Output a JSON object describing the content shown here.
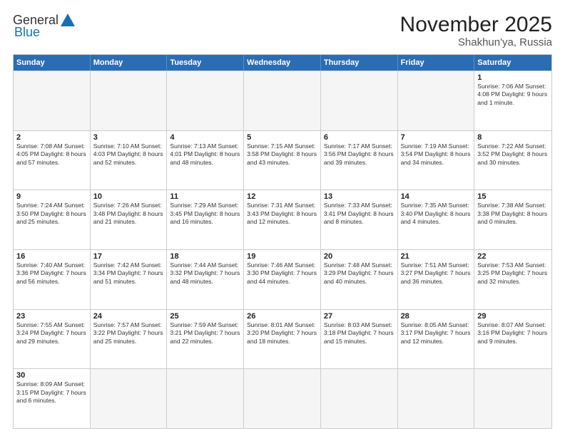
{
  "header": {
    "logo_general": "General",
    "logo_blue": "Blue",
    "title": "November 2025",
    "subtitle": "Shakhun'ya, Russia"
  },
  "weekdays": [
    "Sunday",
    "Monday",
    "Tuesday",
    "Wednesday",
    "Thursday",
    "Friday",
    "Saturday"
  ],
  "weeks": [
    [
      {
        "day": "",
        "info": "",
        "empty": true
      },
      {
        "day": "",
        "info": "",
        "empty": true
      },
      {
        "day": "",
        "info": "",
        "empty": true
      },
      {
        "day": "",
        "info": "",
        "empty": true
      },
      {
        "day": "",
        "info": "",
        "empty": true
      },
      {
        "day": "",
        "info": "",
        "empty": true
      },
      {
        "day": "1",
        "info": "Sunrise: 7:06 AM\nSunset: 4:08 PM\nDaylight: 9 hours\nand 1 minute."
      }
    ],
    [
      {
        "day": "2",
        "info": "Sunrise: 7:08 AM\nSunset: 4:05 PM\nDaylight: 8 hours\nand 57 minutes."
      },
      {
        "day": "3",
        "info": "Sunrise: 7:10 AM\nSunset: 4:03 PM\nDaylight: 8 hours\nand 52 minutes."
      },
      {
        "day": "4",
        "info": "Sunrise: 7:13 AM\nSunset: 4:01 PM\nDaylight: 8 hours\nand 48 minutes."
      },
      {
        "day": "5",
        "info": "Sunrise: 7:15 AM\nSunset: 3:58 PM\nDaylight: 8 hours\nand 43 minutes."
      },
      {
        "day": "6",
        "info": "Sunrise: 7:17 AM\nSunset: 3:56 PM\nDaylight: 8 hours\nand 39 minutes."
      },
      {
        "day": "7",
        "info": "Sunrise: 7:19 AM\nSunset: 3:54 PM\nDaylight: 8 hours\nand 34 minutes."
      },
      {
        "day": "8",
        "info": "Sunrise: 7:22 AM\nSunset: 3:52 PM\nDaylight: 8 hours\nand 30 minutes."
      }
    ],
    [
      {
        "day": "9",
        "info": "Sunrise: 7:24 AM\nSunset: 3:50 PM\nDaylight: 8 hours\nand 25 minutes."
      },
      {
        "day": "10",
        "info": "Sunrise: 7:26 AM\nSunset: 3:48 PM\nDaylight: 8 hours\nand 21 minutes."
      },
      {
        "day": "11",
        "info": "Sunrise: 7:29 AM\nSunset: 3:45 PM\nDaylight: 8 hours\nand 16 minutes."
      },
      {
        "day": "12",
        "info": "Sunrise: 7:31 AM\nSunset: 3:43 PM\nDaylight: 8 hours\nand 12 minutes."
      },
      {
        "day": "13",
        "info": "Sunrise: 7:33 AM\nSunset: 3:41 PM\nDaylight: 8 hours\nand 8 minutes."
      },
      {
        "day": "14",
        "info": "Sunrise: 7:35 AM\nSunset: 3:40 PM\nDaylight: 8 hours\nand 4 minutes."
      },
      {
        "day": "15",
        "info": "Sunrise: 7:38 AM\nSunset: 3:38 PM\nDaylight: 8 hours\nand 0 minutes."
      }
    ],
    [
      {
        "day": "16",
        "info": "Sunrise: 7:40 AM\nSunset: 3:36 PM\nDaylight: 7 hours\nand 56 minutes."
      },
      {
        "day": "17",
        "info": "Sunrise: 7:42 AM\nSunset: 3:34 PM\nDaylight: 7 hours\nand 51 minutes."
      },
      {
        "day": "18",
        "info": "Sunrise: 7:44 AM\nSunset: 3:32 PM\nDaylight: 7 hours\nand 48 minutes."
      },
      {
        "day": "19",
        "info": "Sunrise: 7:46 AM\nSunset: 3:30 PM\nDaylight: 7 hours\nand 44 minutes."
      },
      {
        "day": "20",
        "info": "Sunrise: 7:48 AM\nSunset: 3:29 PM\nDaylight: 7 hours\nand 40 minutes."
      },
      {
        "day": "21",
        "info": "Sunrise: 7:51 AM\nSunset: 3:27 PM\nDaylight: 7 hours\nand 36 minutes."
      },
      {
        "day": "22",
        "info": "Sunrise: 7:53 AM\nSunset: 3:25 PM\nDaylight: 7 hours\nand 32 minutes."
      }
    ],
    [
      {
        "day": "23",
        "info": "Sunrise: 7:55 AM\nSunset: 3:24 PM\nDaylight: 7 hours\nand 29 minutes."
      },
      {
        "day": "24",
        "info": "Sunrise: 7:57 AM\nSunset: 3:22 PM\nDaylight: 7 hours\nand 25 minutes."
      },
      {
        "day": "25",
        "info": "Sunrise: 7:59 AM\nSunset: 3:21 PM\nDaylight: 7 hours\nand 22 minutes."
      },
      {
        "day": "26",
        "info": "Sunrise: 8:01 AM\nSunset: 3:20 PM\nDaylight: 7 hours\nand 18 minutes."
      },
      {
        "day": "27",
        "info": "Sunrise: 8:03 AM\nSunset: 3:18 PM\nDaylight: 7 hours\nand 15 minutes."
      },
      {
        "day": "28",
        "info": "Sunrise: 8:05 AM\nSunset: 3:17 PM\nDaylight: 7 hours\nand 12 minutes."
      },
      {
        "day": "29",
        "info": "Sunrise: 8:07 AM\nSunset: 3:16 PM\nDaylight: 7 hours\nand 9 minutes."
      }
    ],
    [
      {
        "day": "30",
        "info": "Sunrise: 8:09 AM\nSunset: 3:15 PM\nDaylight: 7 hours\nand 6 minutes."
      },
      {
        "day": "",
        "info": "",
        "empty": true
      },
      {
        "day": "",
        "info": "",
        "empty": true
      },
      {
        "day": "",
        "info": "",
        "empty": true
      },
      {
        "day": "",
        "info": "",
        "empty": true
      },
      {
        "day": "",
        "info": "",
        "empty": true
      },
      {
        "day": "",
        "info": "",
        "empty": true
      }
    ]
  ]
}
